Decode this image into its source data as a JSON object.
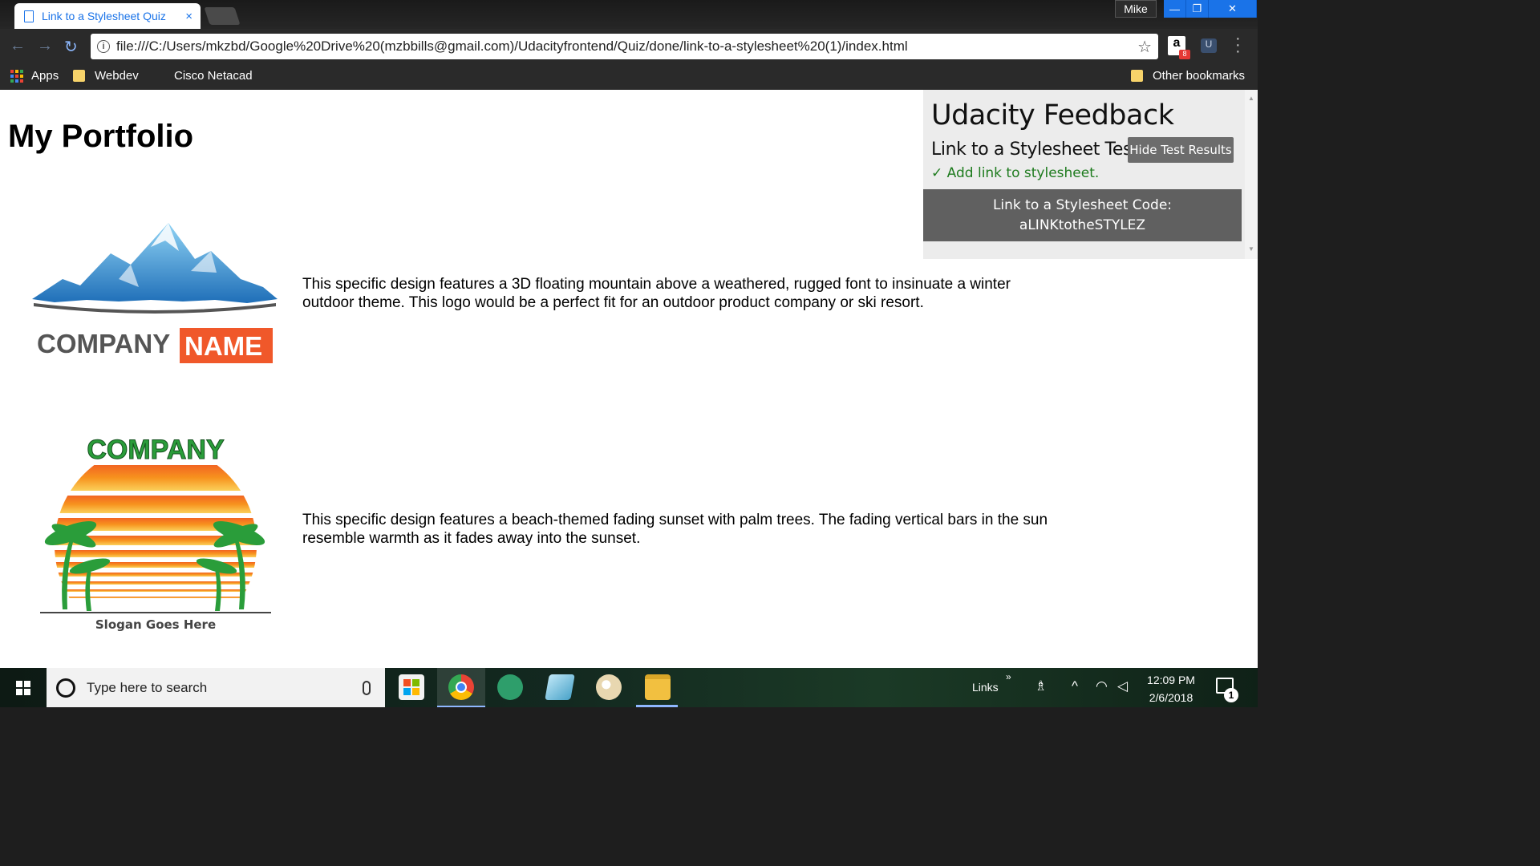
{
  "browser": {
    "tab_title": "Link to a Stylesheet Quiz",
    "tab_close": "×",
    "user_name": "Mike",
    "window_buttons": {
      "minimize": "—",
      "restore": "❐",
      "close": "✕"
    },
    "url": "file:///C:/Users/mkzbd/Google%20Drive%20(mzbbills@gmail.com)/Udacityfrontend/Quiz/done/link-to-a-stylesheet%20(1)/index.html",
    "extension_badge": "8",
    "extension_amazon": "a",
    "extension_u": "U",
    "bookmarks": [
      {
        "label": "Apps"
      },
      {
        "label": "Webdev"
      },
      {
        "label": "Cisco Netacad"
      }
    ],
    "other_bookmarks": "Other bookmarks"
  },
  "page": {
    "title": "My Portfolio",
    "items": [
      {
        "description": "This specific design features a 3D floating mountain above a weathered, rugged font to insinuate a winter outdoor theme. This logo would be a perfect fit for an outdoor product company or ski resort.",
        "logo_text_1": "COMPANY",
        "logo_text_2": "NAME"
      },
      {
        "description": "This specific design features a beach-themed fading sunset with palm trees. The fading vertical bars in the sun resemble warmth as it fades away into the sunset.",
        "logo_text_1": "COMPANY",
        "logo_text_2": "Slogan Goes Here"
      }
    ]
  },
  "feedback": {
    "title": "Udacity Feedback",
    "test_name": "Link to a Stylesheet Test",
    "hide_button": "Hide Test Results",
    "check": "✓ Add link to stylesheet.",
    "code_line_1": "Link to a Stylesheet Code:",
    "code_line_2": "aLINKtotheSTYLEZ"
  },
  "taskbar": {
    "search_placeholder": "Type here to search",
    "links_label": "Links",
    "time": "12:09 PM",
    "date": "2/6/2018",
    "notification_count": "1"
  },
  "colors": {
    "tab_accent": "#1a73e8",
    "check_green": "#1e7b1e",
    "code_bg": "#606060",
    "logo_orange": "#f0582a",
    "logo_blue": "#3d8fd1",
    "sunset_orange": "#f7931e",
    "palm_green": "#2a9d3a"
  }
}
